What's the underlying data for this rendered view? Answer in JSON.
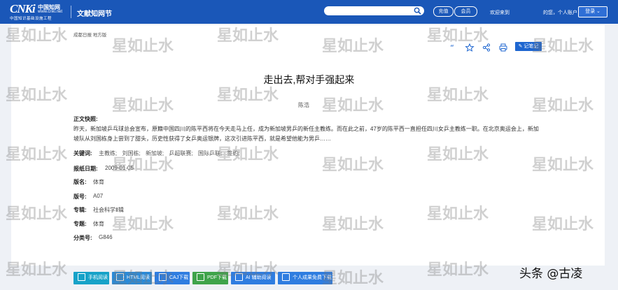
{
  "header": {
    "logo_main": "CNKi",
    "logo_cn": "中国知网",
    "logo_url": "www.cnki.net",
    "logo_sub": "中国知识基础设施工程",
    "site_name": "文献知网节",
    "search_placeholder": "",
    "btn_recharge": "充值",
    "btn_vip": "会员",
    "welcome": "欢迎来到",
    "user": "的您，个人账户",
    "login": "登录"
  },
  "article": {
    "source": "成都日报 地方版",
    "title": "走出去,帮对手强起来",
    "author": "陈浩",
    "note_button": "记笔记",
    "abstract_label": "正文快照:",
    "abstract": "昨天，新加坡乒乓球总会宣布，原籍中国四川的陈平西将在今天走马上任，成为新加坡男乒的新任主教练。而在此之前，47岁的陈平西一直担任四川女乒主教练一职。在北京奥运会上，新加坡队从刘国栋身上尝到了甜头，历史性获得了女乒奥运银牌，这次引进陈平西，就是希望他能为男乒……",
    "keywords_label": "关键词:",
    "keywords": [
      "主教练;",
      "刘国栋;",
      "新加坡;",
      "乒超联赛;",
      "国际乒联;",
      "签约;"
    ],
    "date_label": "报纸日期:",
    "date": "2009-01-05",
    "column_label": "版名:",
    "column": "体育",
    "page_label": "版号:",
    "page": "A07",
    "series_label": "专辑:",
    "series": "社会科学Ⅱ辑",
    "topic_label": "专题:",
    "topic": "体育",
    "class_label": "分类号:",
    "class_no": "G846"
  },
  "actions": [
    {
      "label": "手机阅读",
      "color": "#17a2c8"
    },
    {
      "label": "HTML阅读",
      "color": "#2a8ad8"
    },
    {
      "label": "CAJ下载",
      "color": "#2f7de0"
    },
    {
      "label": "PDF下载",
      "color": "#3fa34a"
    },
    {
      "label": "AI 辅助阅读",
      "color": "#2f7de0"
    },
    {
      "label": "个人成果免费下载",
      "color": "#2f7de0"
    }
  ],
  "watermark": "星如止水",
  "credit": "头条 @古凌",
  "colors": {
    "brand": "#1a57b8",
    "accent": "#1e66d0"
  }
}
